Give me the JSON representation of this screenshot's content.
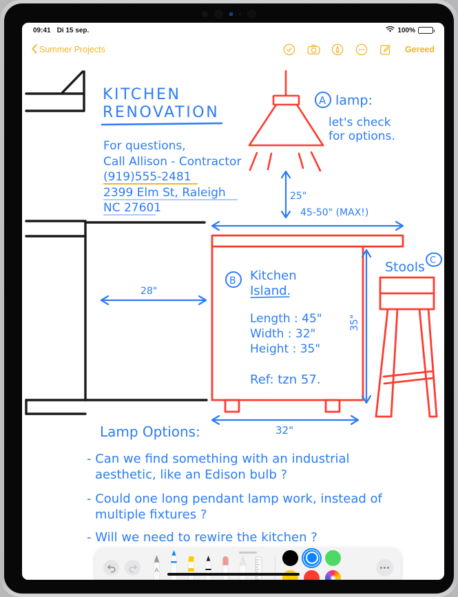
{
  "status_bar": {
    "time": "09:41",
    "date": "Di 15 sep.",
    "wifi_icon": "wifi-icon",
    "battery_percent": "100%"
  },
  "nav_bar": {
    "back_label": "Summer Projects",
    "back_icon": "chevron-left-icon",
    "tools": [
      {
        "name": "checkmark-circle-icon",
        "label": "Markup complete"
      },
      {
        "name": "camera-icon",
        "label": "Insert photo"
      },
      {
        "name": "markup-pen-circle-icon",
        "label": "Markup"
      },
      {
        "name": "more-circle-icon",
        "label": "More"
      },
      {
        "name": "compose-icon",
        "label": "New note"
      }
    ],
    "done_label": "Gereed"
  },
  "note": {
    "title_line_1": "KITCHEN",
    "title_line_2": "RENOVATION",
    "contact": {
      "line_1": "For questions,",
      "line_2": "Call Allison - Contractor",
      "phone": "(919)555-2481",
      "address_line_1": "2399 Elm St, Raleigh",
      "address_line_2": "NC 27601"
    },
    "annotations": {
      "lamp_marker": "A",
      "lamp_title": "lamp:",
      "lamp_note_1": "let's check",
      "lamp_note_2": "for options.",
      "lamp_drop_dimension": "25\"",
      "island_top_dimension": "45-50\" (MAX!)",
      "island_marker": "B",
      "island_title_1": "Kitchen",
      "island_title_2": "Island.",
      "island_length": "Length : 45\"",
      "island_width": "Width : 32\"",
      "island_height": "Height : 35\"",
      "island_ref": "Ref: tzn 57.",
      "island_height_dimension": "35\"",
      "island_bottom_dimension": "32\"",
      "wall_gap_dimension": "28\"",
      "stools_label": "Stools",
      "stools_marker": "C"
    },
    "lamp_options": {
      "heading": "Lamp Options:",
      "items": [
        "- Can we find something with an industrial",
        "aesthetic, like an Edison bulb ?",
        "- Could one long pendant lamp work, instead of",
        "multiple fixtures ?",
        "- Will we need to rewire the kitchen ?"
      ]
    }
  },
  "palette": {
    "undo_icon": "undo-icon",
    "redo_icon": "redo-icon",
    "tools": [
      {
        "name": "tool-text-pen",
        "label": "Text / A pen",
        "selected": false
      },
      {
        "name": "tool-pen",
        "label": "Pen",
        "selected": true
      },
      {
        "name": "tool-highlighter",
        "label": "Highlighter",
        "selected": false
      },
      {
        "name": "tool-marker",
        "label": "Marker",
        "selected": false
      },
      {
        "name": "tool-eraser",
        "label": "Eraser",
        "selected": false
      },
      {
        "name": "tool-pencil",
        "label": "Pencil",
        "selected": false
      },
      {
        "name": "tool-ruler",
        "label": "Ruler",
        "selected": false
      }
    ],
    "colors": [
      {
        "name": "color-black",
        "hex": "#000000",
        "selected": false
      },
      {
        "name": "color-blue",
        "hex": "#0a84ff",
        "selected": true
      },
      {
        "name": "color-green",
        "hex": "#4cd964",
        "selected": false
      },
      {
        "name": "color-yellow",
        "hex": "#ffcc00",
        "selected": false
      },
      {
        "name": "color-red",
        "hex": "#ff3b30",
        "selected": false
      },
      {
        "name": "color-wheel",
        "hex": "wheel",
        "selected": false
      }
    ],
    "more_icon": "more-icon"
  },
  "theme": {
    "accent": "#f0b429",
    "ink_blue": "#2b7cf5",
    "ink_red": "#ff3b30",
    "ink_black": "#1a1a1a",
    "highlight_yellow": "#f5c043"
  }
}
